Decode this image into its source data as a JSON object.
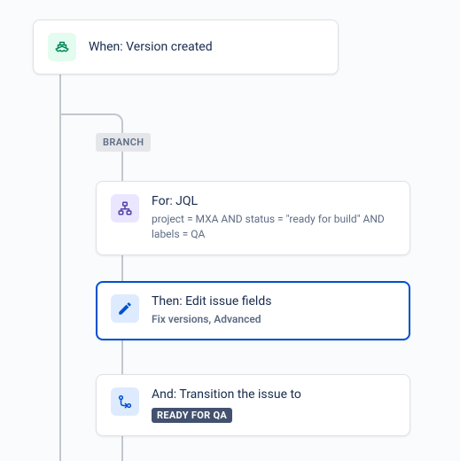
{
  "trigger": {
    "title": "When: Version created"
  },
  "branch": {
    "label": "BRANCH"
  },
  "components": [
    {
      "title": "For: JQL",
      "subtitle": "project = MXA AND status = \"ready for build\" AND labels = QA"
    },
    {
      "title": "Then: Edit issue fields",
      "subtitle": "Fix versions, Advanced"
    },
    {
      "title": "And: Transition the issue to",
      "status": "READY FOR QA"
    }
  ]
}
